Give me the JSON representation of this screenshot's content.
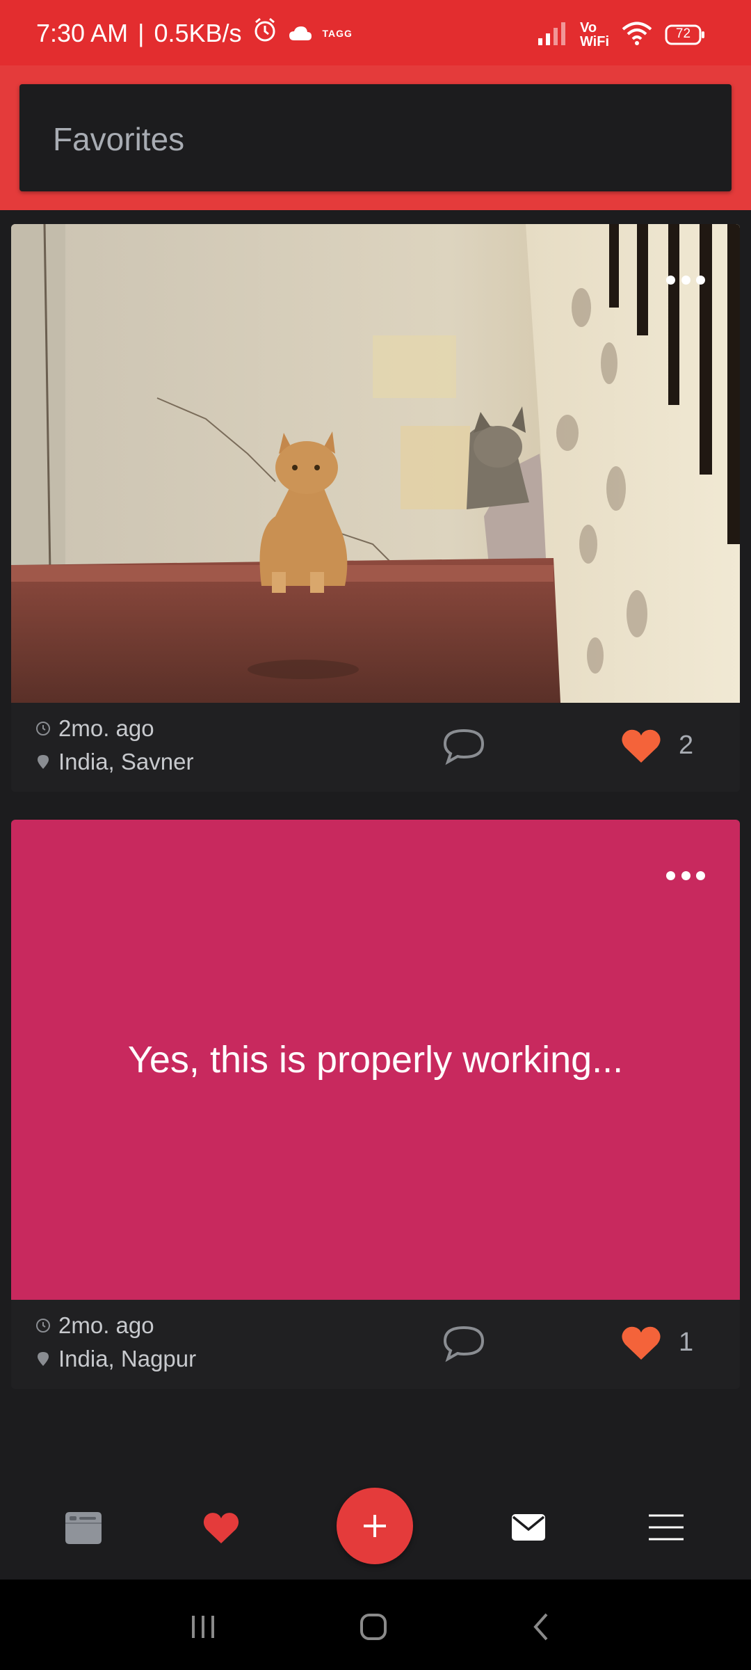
{
  "status_bar": {
    "time": "7:30 AM",
    "separator": "|",
    "network_speed": "0.5KB/s",
    "tagg_label": "TAGG",
    "volte_top": "Vo",
    "volte_bottom": "WiFi",
    "battery": "72",
    "icons": [
      "alarm-icon",
      "cloud-icon",
      "signal-icon",
      "wifi-icon",
      "battery-icon"
    ]
  },
  "header": {
    "title": "Favorites"
  },
  "posts": [
    {
      "type": "photo",
      "photo_subject": "cat-photo",
      "time": "2mo. ago",
      "location": "India, Savner",
      "likes": "2",
      "liked": true
    },
    {
      "type": "text",
      "text": "Yes, this is properly working...",
      "background_color": "#c8295e",
      "time": "2mo. ago",
      "location": "India, Nagpur",
      "likes": "1",
      "liked": true
    }
  ],
  "bottom_nav": {
    "items": [
      {
        "name": "feed-icon",
        "active": false
      },
      {
        "name": "heart-icon",
        "active": true
      },
      {
        "name": "add-icon",
        "active": false
      },
      {
        "name": "mail-icon",
        "active": false
      },
      {
        "name": "menu-icon",
        "active": false
      }
    ]
  },
  "system_nav": {
    "buttons": [
      "recents-icon",
      "home-icon",
      "back-icon"
    ]
  },
  "colors": {
    "status_bar": "#e32d2f",
    "header": "#e43b3b",
    "background": "#1c1c1e",
    "card": "#202022",
    "like": "#f4633a",
    "text_post": "#c8295e"
  }
}
